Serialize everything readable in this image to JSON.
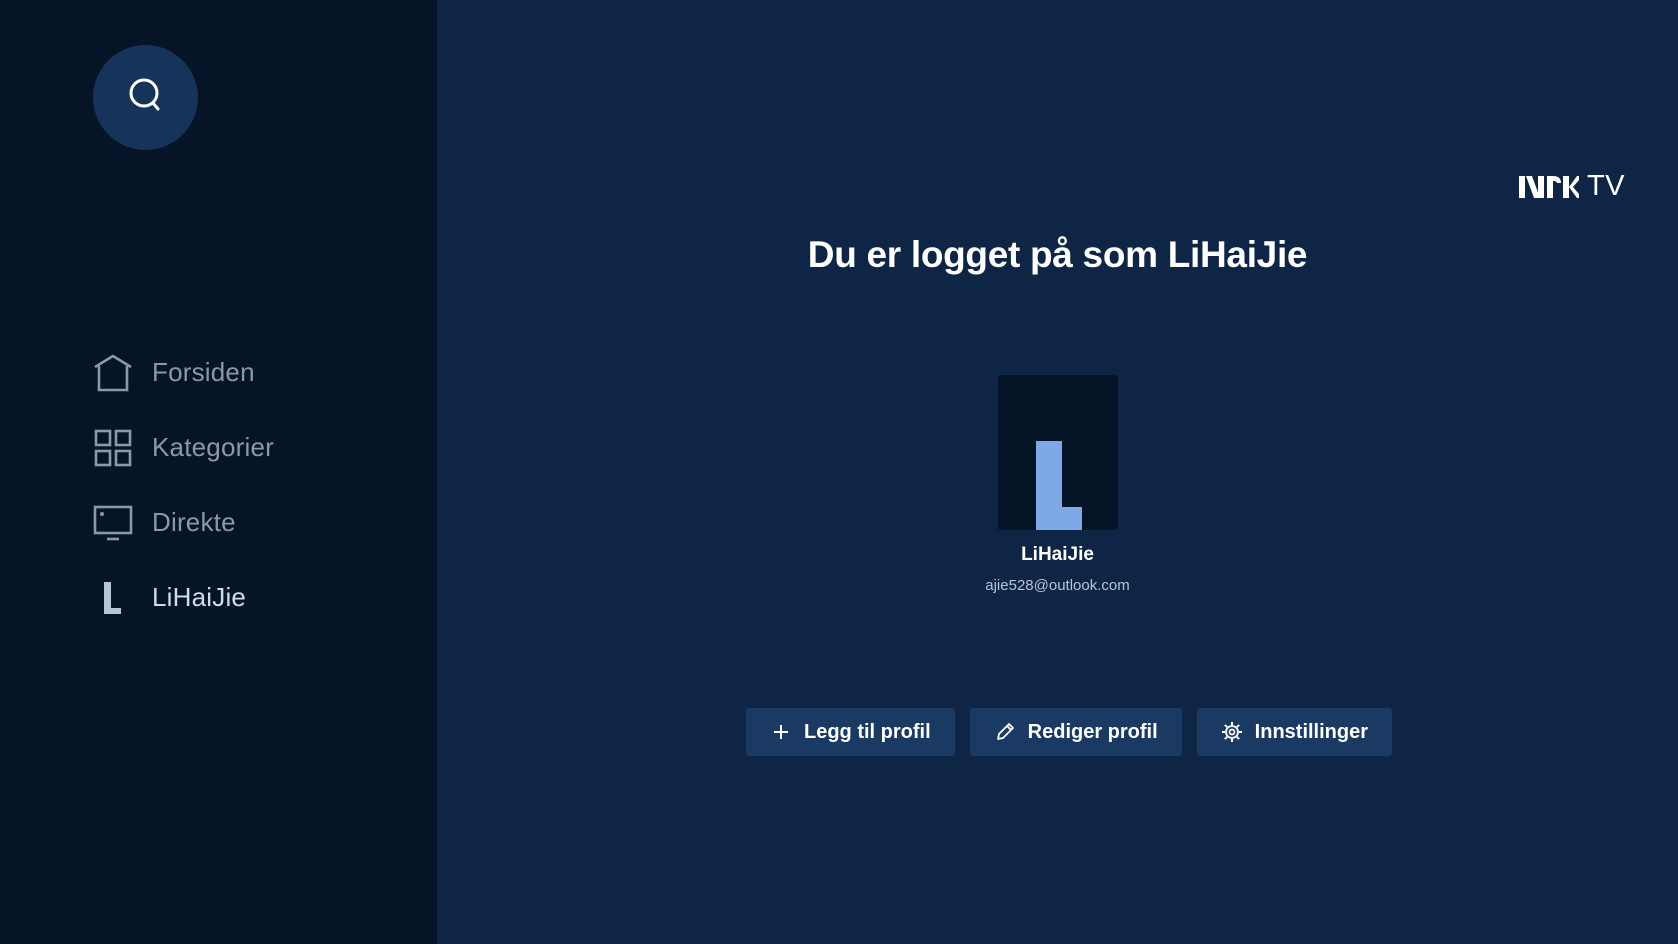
{
  "sidebar": {
    "search_icon": "search-icon",
    "items": [
      {
        "label": "Forsiden",
        "icon": "home-icon"
      },
      {
        "label": "Kategorier",
        "icon": "grid-icon"
      },
      {
        "label": "Direkte",
        "icon": "tv-icon"
      },
      {
        "label": "LiHaiJie",
        "icon": "profile-letter-icon",
        "active": true
      }
    ]
  },
  "header": {
    "logo_brand": "NRK",
    "logo_suffix": "TV"
  },
  "main": {
    "title": "Du er logget på som LiHaiJie",
    "profile": {
      "avatar_letter": "L",
      "name": "LiHaiJie",
      "email": "ajie528@outlook.com"
    },
    "actions": [
      {
        "label": "Legg til profil",
        "icon": "plus-icon"
      },
      {
        "label": "Rediger profil",
        "icon": "pencil-icon"
      },
      {
        "label": "Innstillinger",
        "icon": "gear-icon"
      }
    ]
  },
  "colors": {
    "background": "#0e2546",
    "sidebar": "#061428",
    "button": "#1a3a63",
    "avatar_letter": "#7fa8e6"
  }
}
